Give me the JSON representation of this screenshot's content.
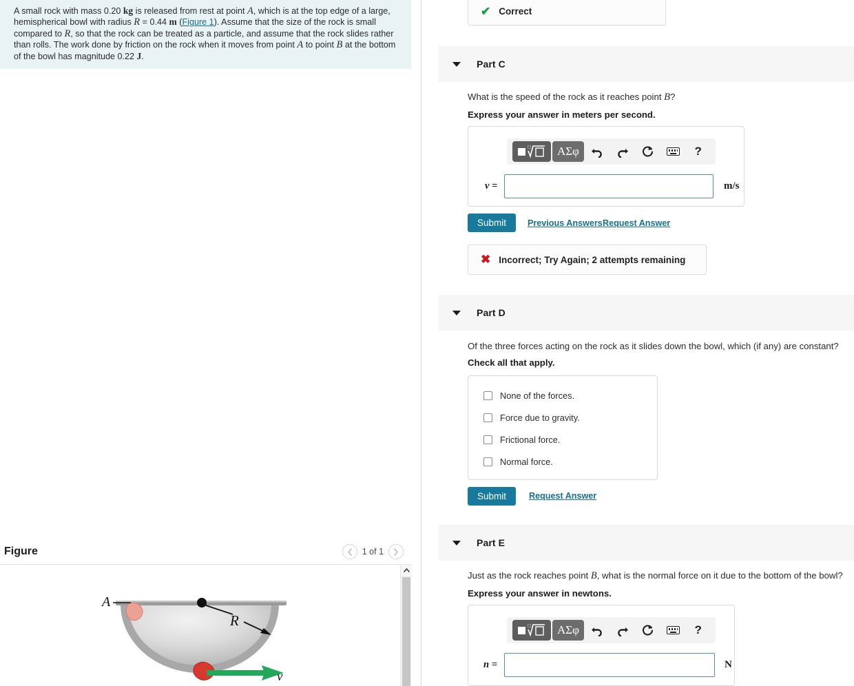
{
  "problem": {
    "text_segments": [
      {
        "t": "A small rock with mass 0.20 ",
        "s": "plain"
      },
      {
        "t": "kg",
        "s": "up"
      },
      {
        "t": " is released from rest at point ",
        "s": "plain"
      },
      {
        "t": "A",
        "s": "var"
      },
      {
        "t": ", which is at the top edge of a large, hemispherical bowl with radius ",
        "s": "plain"
      },
      {
        "t": "R",
        "s": "var"
      },
      {
        "t": " = 0.44 ",
        "s": "plain"
      },
      {
        "t": "m",
        "s": "up"
      },
      {
        "t": " (",
        "s": "plain"
      },
      {
        "t": "Figure 1",
        "s": "link"
      },
      {
        "t": "). Assume that the size of the rock is small compared to ",
        "s": "plain"
      },
      {
        "t": "R",
        "s": "var"
      },
      {
        "t": ", so that the rock can be treated as a particle, and assume that the rock slides rather than rolls. The work done by friction on the rock when it moves from point ",
        "s": "plain"
      },
      {
        "t": "A",
        "s": "var"
      },
      {
        "t": " to point ",
        "s": "plain"
      },
      {
        "t": "B",
        "s": "var"
      },
      {
        "t": " at the bottom of the bowl has magnitude 0.22 ",
        "s": "plain"
      },
      {
        "t": "J",
        "s": "up"
      },
      {
        "t": ".",
        "s": "plain"
      }
    ],
    "mass_value": "0.20",
    "mass_unit": "kg",
    "radius_value": "0.44",
    "radius_unit": "m",
    "friction_work_value": "0.22",
    "friction_work_unit": "J",
    "figure_link_label": "Figure 1"
  },
  "figure": {
    "title": "Figure",
    "counter": "1 of 1",
    "prev_icon": "chevron-left-icon",
    "next_icon": "chevron-right-icon",
    "scroll_up_icon": "chevron-up-icon",
    "labels": {
      "point_a": "A",
      "radius": "R",
      "velocity": "v"
    },
    "colors": {
      "bowl_rim": "#8e8e8e",
      "bowl_fill": "#d6d6d6",
      "rock_top": "#e8a090",
      "rock_bottom": "#d9382e",
      "velocity_arrow": "#22a85a"
    }
  },
  "part_b_feedback": {
    "icon": "check-icon",
    "text": "Correct",
    "color": "#1a9c48"
  },
  "part_c": {
    "label": "Part C",
    "caret_icon": "caret-down-icon",
    "question": "What is the speed of the rock as it reaches point ",
    "question_var": "B",
    "question_tail": "?",
    "instruction": "Express your answer in meters per second.",
    "var_label": "v =",
    "input_value": "",
    "input_placeholder": "",
    "unit": "m/s",
    "toolbar": {
      "template_button": "template-icon",
      "greek_button": "ΑΣφ",
      "undo_icon": "undo-icon",
      "redo_icon": "redo-icon",
      "reset_icon": "reset-icon",
      "keyboard_icon": "keyboard-icon",
      "help_icon": "?"
    },
    "submit_label": "Submit",
    "previous_answers_label": "Previous Answers",
    "request_answer_label": "Request Answer",
    "feedback": {
      "icon": "x-icon",
      "text": "Incorrect; Try Again; 2 attempts remaining",
      "color": "#c9171e"
    }
  },
  "part_d": {
    "label": "Part D",
    "caret_icon": "caret-down-icon",
    "question": "Of the three forces acting on the rock as it slides down the bowl, which (if any) are constant?",
    "instruction": "Check all that apply.",
    "choices": [
      {
        "label": "None of the forces.",
        "checked": false
      },
      {
        "label": "Force due to gravity.",
        "checked": false
      },
      {
        "label": "Frictional force.",
        "checked": false
      },
      {
        "label": "Normal force.",
        "checked": false
      }
    ],
    "submit_label": "Submit",
    "request_answer_label": "Request Answer"
  },
  "part_e": {
    "label": "Part E",
    "caret_icon": "caret-down-icon",
    "question_head": "Just as the rock reaches point ",
    "question_var": "B",
    "question_tail": ", what is the normal force on it due to the bottom of the bowl?",
    "instruction": "Express your answer in newtons.",
    "var_label": "n =",
    "input_value": "",
    "unit": "N",
    "toolbar": {
      "template_button": "template-icon",
      "greek_button": "ΑΣφ",
      "undo_icon": "undo-icon",
      "redo_icon": "redo-icon",
      "reset_icon": "reset-icon",
      "keyboard_icon": "keyboard-icon",
      "help_icon": "?"
    }
  },
  "theme": {
    "accent": "#17799c",
    "link": "#16708f",
    "problem_bg": "#e9f3f3",
    "part_header_bg": "#f6f6f6",
    "input_border": "#4f8f9e"
  }
}
